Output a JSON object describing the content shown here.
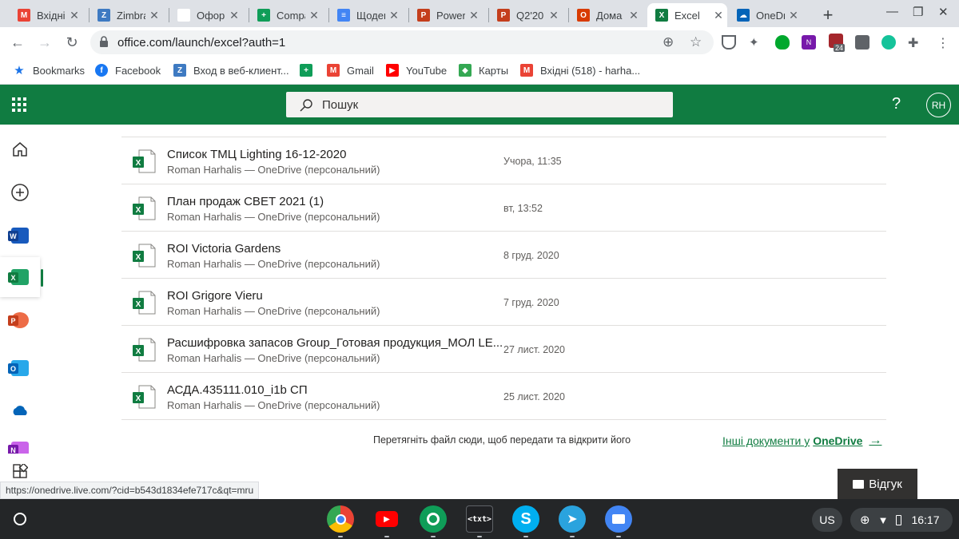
{
  "tabs": [
    {
      "title": "Вхідні",
      "icon": "gmail-icon",
      "color": "#ea4335",
      "letter": "M",
      "active": false
    },
    {
      "title": "Zimbra",
      "icon": "zimbra-icon",
      "color": "#3e7ac2",
      "letter": "Z",
      "active": false
    },
    {
      "title": "Оформ",
      "icon": "blank-page-icon",
      "color": "#ffffff",
      "letter": "",
      "active": false
    },
    {
      "title": "Compa",
      "icon": "google-sheets-icon",
      "color": "#0f9d58",
      "letter": "+",
      "active": false
    },
    {
      "title": "Щоден",
      "icon": "google-docs-icon",
      "color": "#4285f4",
      "letter": "≡",
      "active": false
    },
    {
      "title": "Power",
      "icon": "powerpoint-icon",
      "color": "#c43e1c",
      "letter": "P",
      "active": false
    },
    {
      "title": "Q2'20",
      "icon": "powerpoint-icon",
      "color": "#c43e1c",
      "letter": "P",
      "active": false
    },
    {
      "title": "Дома",
      "icon": "office-icon",
      "color": "#d83b01",
      "letter": "O",
      "active": false
    },
    {
      "title": "Excel",
      "icon": "excel-icon",
      "color": "#107c41",
      "letter": "X",
      "active": true
    },
    {
      "title": "OneDr",
      "icon": "onedrive-icon",
      "color": "#0364b8",
      "letter": "☁",
      "active": false
    }
  ],
  "toolbar": {
    "url": "office.com/launch/excel?auth=1"
  },
  "bookmarks": [
    {
      "label": "Bookmarks",
      "icon": "star-icon",
      "color": "#1a73e8",
      "letter": "★"
    },
    {
      "label": "Facebook",
      "icon": "facebook-icon",
      "color": "#1877f2",
      "letter": "f"
    },
    {
      "label": "Вход в веб-клиент...",
      "icon": "zimbra-icon",
      "color": "#3e7ac2",
      "letter": "Z"
    },
    {
      "label": "",
      "icon": "google-sheets-icon",
      "color": "#0f9d58",
      "letter": "+"
    },
    {
      "label": "Gmail",
      "icon": "gmail-icon",
      "color": "#ea4335",
      "letter": "M"
    },
    {
      "label": "YouTube",
      "icon": "youtube-icon",
      "color": "#ff0000",
      "letter": "▶"
    },
    {
      "label": "Карты",
      "icon": "maps-icon",
      "color": "#34a853",
      "letter": "◆"
    },
    {
      "label": "Вхідні (518) - harha...",
      "icon": "gmail-icon",
      "color": "#ea4335",
      "letter": "M"
    }
  ],
  "extensions": {
    "badge": "24"
  },
  "header": {
    "search_placeholder": "Пошук",
    "help": "?",
    "avatar_initials": "RH"
  },
  "files": [
    {
      "name": "Список ТМЦ Lighting 16-12-2020",
      "location": "Roman Harhalis — OneDrive (персональний)",
      "date": "Учора, 11:35"
    },
    {
      "name": "План продаж СВЕТ 2021 (1)",
      "location": "Roman Harhalis — OneDrive (персональний)",
      "date": "вт, 13:52"
    },
    {
      "name": "ROI Victoria Gardens",
      "location": "Roman Harhalis — OneDrive (персональний)",
      "date": "8 груд. 2020"
    },
    {
      "name": "ROI Grigore Vieru",
      "location": "Roman Harhalis — OneDrive (персональний)",
      "date": "7 груд. 2020"
    },
    {
      "name": "Расшифровка запасов Group_Готовая продукция_МОЛ LE...",
      "location": "Roman Harhalis — OneDrive (персональний)",
      "date": "27 лист. 2020"
    },
    {
      "name": "АСДА.435111.010_i1b СП",
      "location": "Roman Harhalis — OneDrive (персональний)",
      "date": "25 лист. 2020"
    }
  ],
  "footer": {
    "drop_hint": "Перетягніть файл сюди, щоб передати та відкрити його",
    "more_docs_prefix": "Інші документи у",
    "more_docs_brand": "OneDrive",
    "feedback": "Відгук"
  },
  "status_url": "https://onedrive.live.com/?cid=b543d1834efe717c&qt=mru",
  "shelf": {
    "apps": [
      "chrome-icon",
      "youtube-icon",
      "hangouts-icon",
      "text-editor-icon",
      "skype-icon",
      "telegram-icon",
      "files-icon"
    ],
    "text_app_label": "<txt>",
    "keyboard": "US",
    "time": "16:17"
  },
  "colors": {
    "excel_green": "#107c41",
    "word_blue": "#185abd",
    "powerpoint_red": "#c43e1c",
    "outlook_blue": "#0364b8"
  }
}
